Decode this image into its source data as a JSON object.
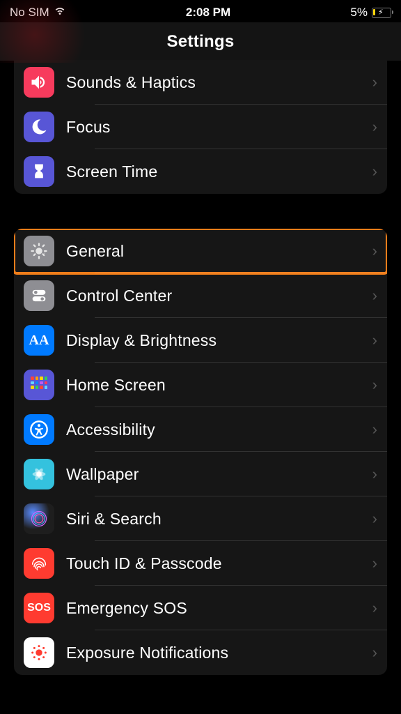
{
  "status": {
    "carrier": "No SIM",
    "time": "2:08 PM",
    "battery_pct": "5%"
  },
  "header": {
    "title": "Settings"
  },
  "group1": [
    {
      "id": "sounds",
      "label": "Sounds & Haptics"
    },
    {
      "id": "focus",
      "label": "Focus"
    },
    {
      "id": "screentime",
      "label": "Screen Time"
    }
  ],
  "group2": [
    {
      "id": "general",
      "label": "General",
      "highlighted": true
    },
    {
      "id": "controlcenter",
      "label": "Control Center"
    },
    {
      "id": "display",
      "label": "Display & Brightness"
    },
    {
      "id": "homescreen",
      "label": "Home Screen"
    },
    {
      "id": "accessibility",
      "label": "Accessibility"
    },
    {
      "id": "wallpaper",
      "label": "Wallpaper"
    },
    {
      "id": "siri",
      "label": "Siri & Search"
    },
    {
      "id": "touchid",
      "label": "Touch ID & Passcode"
    },
    {
      "id": "sos",
      "label": "Emergency SOS"
    },
    {
      "id": "exposure",
      "label": "Exposure Notifications"
    }
  ]
}
